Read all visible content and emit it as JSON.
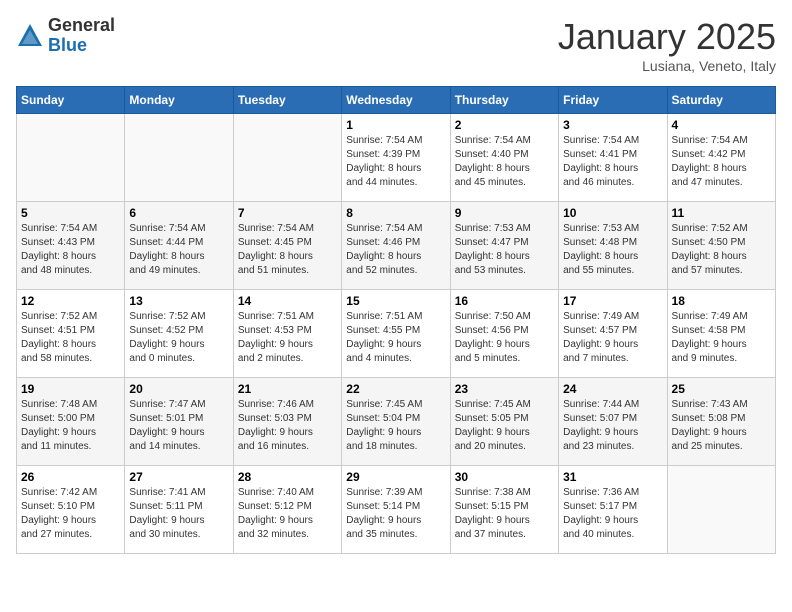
{
  "header": {
    "logo_general": "General",
    "logo_blue": "Blue",
    "title": "January 2025",
    "subtitle": "Lusiana, Veneto, Italy"
  },
  "weekdays": [
    "Sunday",
    "Monday",
    "Tuesday",
    "Wednesday",
    "Thursday",
    "Friday",
    "Saturday"
  ],
  "weeks": [
    [
      {
        "day": "",
        "info": ""
      },
      {
        "day": "",
        "info": ""
      },
      {
        "day": "",
        "info": ""
      },
      {
        "day": "1",
        "info": "Sunrise: 7:54 AM\nSunset: 4:39 PM\nDaylight: 8 hours\nand 44 minutes."
      },
      {
        "day": "2",
        "info": "Sunrise: 7:54 AM\nSunset: 4:40 PM\nDaylight: 8 hours\nand 45 minutes."
      },
      {
        "day": "3",
        "info": "Sunrise: 7:54 AM\nSunset: 4:41 PM\nDaylight: 8 hours\nand 46 minutes."
      },
      {
        "day": "4",
        "info": "Sunrise: 7:54 AM\nSunset: 4:42 PM\nDaylight: 8 hours\nand 47 minutes."
      }
    ],
    [
      {
        "day": "5",
        "info": "Sunrise: 7:54 AM\nSunset: 4:43 PM\nDaylight: 8 hours\nand 48 minutes."
      },
      {
        "day": "6",
        "info": "Sunrise: 7:54 AM\nSunset: 4:44 PM\nDaylight: 8 hours\nand 49 minutes."
      },
      {
        "day": "7",
        "info": "Sunrise: 7:54 AM\nSunset: 4:45 PM\nDaylight: 8 hours\nand 51 minutes."
      },
      {
        "day": "8",
        "info": "Sunrise: 7:54 AM\nSunset: 4:46 PM\nDaylight: 8 hours\nand 52 minutes."
      },
      {
        "day": "9",
        "info": "Sunrise: 7:53 AM\nSunset: 4:47 PM\nDaylight: 8 hours\nand 53 minutes."
      },
      {
        "day": "10",
        "info": "Sunrise: 7:53 AM\nSunset: 4:48 PM\nDaylight: 8 hours\nand 55 minutes."
      },
      {
        "day": "11",
        "info": "Sunrise: 7:52 AM\nSunset: 4:50 PM\nDaylight: 8 hours\nand 57 minutes."
      }
    ],
    [
      {
        "day": "12",
        "info": "Sunrise: 7:52 AM\nSunset: 4:51 PM\nDaylight: 8 hours\nand 58 minutes."
      },
      {
        "day": "13",
        "info": "Sunrise: 7:52 AM\nSunset: 4:52 PM\nDaylight: 9 hours\nand 0 minutes."
      },
      {
        "day": "14",
        "info": "Sunrise: 7:51 AM\nSunset: 4:53 PM\nDaylight: 9 hours\nand 2 minutes."
      },
      {
        "day": "15",
        "info": "Sunrise: 7:51 AM\nSunset: 4:55 PM\nDaylight: 9 hours\nand 4 minutes."
      },
      {
        "day": "16",
        "info": "Sunrise: 7:50 AM\nSunset: 4:56 PM\nDaylight: 9 hours\nand 5 minutes."
      },
      {
        "day": "17",
        "info": "Sunrise: 7:49 AM\nSunset: 4:57 PM\nDaylight: 9 hours\nand 7 minutes."
      },
      {
        "day": "18",
        "info": "Sunrise: 7:49 AM\nSunset: 4:58 PM\nDaylight: 9 hours\nand 9 minutes."
      }
    ],
    [
      {
        "day": "19",
        "info": "Sunrise: 7:48 AM\nSunset: 5:00 PM\nDaylight: 9 hours\nand 11 minutes."
      },
      {
        "day": "20",
        "info": "Sunrise: 7:47 AM\nSunset: 5:01 PM\nDaylight: 9 hours\nand 14 minutes."
      },
      {
        "day": "21",
        "info": "Sunrise: 7:46 AM\nSunset: 5:03 PM\nDaylight: 9 hours\nand 16 minutes."
      },
      {
        "day": "22",
        "info": "Sunrise: 7:45 AM\nSunset: 5:04 PM\nDaylight: 9 hours\nand 18 minutes."
      },
      {
        "day": "23",
        "info": "Sunrise: 7:45 AM\nSunset: 5:05 PM\nDaylight: 9 hours\nand 20 minutes."
      },
      {
        "day": "24",
        "info": "Sunrise: 7:44 AM\nSunset: 5:07 PM\nDaylight: 9 hours\nand 23 minutes."
      },
      {
        "day": "25",
        "info": "Sunrise: 7:43 AM\nSunset: 5:08 PM\nDaylight: 9 hours\nand 25 minutes."
      }
    ],
    [
      {
        "day": "26",
        "info": "Sunrise: 7:42 AM\nSunset: 5:10 PM\nDaylight: 9 hours\nand 27 minutes."
      },
      {
        "day": "27",
        "info": "Sunrise: 7:41 AM\nSunset: 5:11 PM\nDaylight: 9 hours\nand 30 minutes."
      },
      {
        "day": "28",
        "info": "Sunrise: 7:40 AM\nSunset: 5:12 PM\nDaylight: 9 hours\nand 32 minutes."
      },
      {
        "day": "29",
        "info": "Sunrise: 7:39 AM\nSunset: 5:14 PM\nDaylight: 9 hours\nand 35 minutes."
      },
      {
        "day": "30",
        "info": "Sunrise: 7:38 AM\nSunset: 5:15 PM\nDaylight: 9 hours\nand 37 minutes."
      },
      {
        "day": "31",
        "info": "Sunrise: 7:36 AM\nSunset: 5:17 PM\nDaylight: 9 hours\nand 40 minutes."
      },
      {
        "day": "",
        "info": ""
      }
    ]
  ]
}
